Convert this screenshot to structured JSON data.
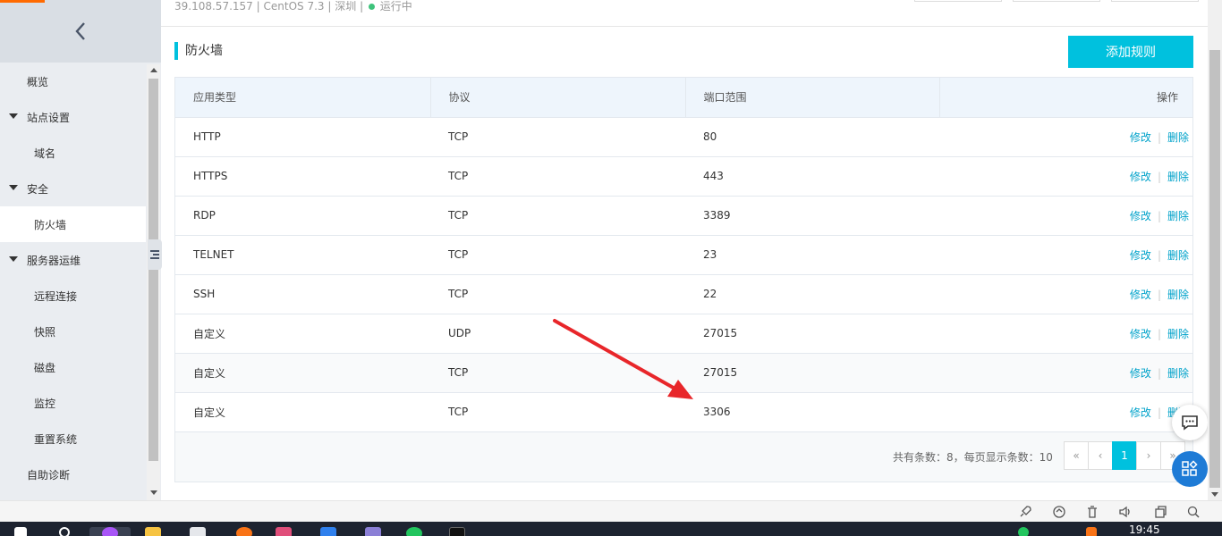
{
  "header": {
    "ip": "39.108.57.157",
    "os": "CentOS 7.3",
    "region": "深圳",
    "status": "运行中",
    "status_color": "#3ec37b",
    "separator": "|"
  },
  "sidebar": {
    "items": [
      {
        "label": "概览"
      },
      {
        "label": "站点设置"
      },
      {
        "label": "域名"
      },
      {
        "label": "安全"
      },
      {
        "label": "防火墙"
      },
      {
        "label": "服务器运维"
      },
      {
        "label": "远程连接"
      },
      {
        "label": "快照"
      },
      {
        "label": "磁盘"
      },
      {
        "label": "监控"
      },
      {
        "label": "重置系统"
      },
      {
        "label": "自助诊断"
      }
    ]
  },
  "main": {
    "title": "防火墙",
    "add_button": "添加规则",
    "accent_color": "#00c1de",
    "table": {
      "headers": [
        "应用类型",
        "协议",
        "端口范围",
        "操作"
      ],
      "rows": [
        {
          "app": "HTTP",
          "protocol": "TCP",
          "port": "80"
        },
        {
          "app": "HTTPS",
          "protocol": "TCP",
          "port": "443"
        },
        {
          "app": "RDP",
          "protocol": "TCP",
          "port": "3389"
        },
        {
          "app": "TELNET",
          "protocol": "TCP",
          "port": "23"
        },
        {
          "app": "SSH",
          "protocol": "TCP",
          "port": "22"
        },
        {
          "app": "自定义",
          "protocol": "UDP",
          "port": "27015"
        },
        {
          "app": "自定义",
          "protocol": "TCP",
          "port": "27015"
        },
        {
          "app": "自定义",
          "protocol": "TCP",
          "port": "3306"
        }
      ],
      "edit_label": "修改",
      "delete_label": "删除",
      "op_separator": "|"
    },
    "pagination": {
      "summary": "共有条数：8，每页显示条数：10",
      "first": "«",
      "prev": "‹",
      "current": "1",
      "next": "›",
      "last": "»"
    }
  },
  "annotation": {
    "type": "red-arrow",
    "color": "#e8262a"
  },
  "taskbar": {
    "clock": "19:45"
  }
}
